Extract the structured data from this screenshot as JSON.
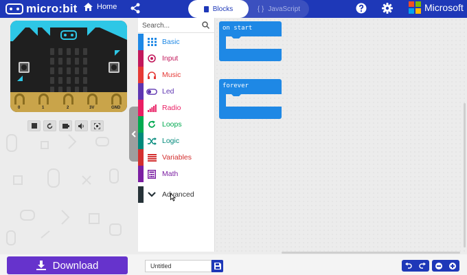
{
  "header": {
    "brand": "micro:bit",
    "home_label": "Home",
    "tabs": [
      {
        "label": "Blocks",
        "active": true
      },
      {
        "label": "JavaScript",
        "active": false
      }
    ],
    "microsoft_label": "Microsoft"
  },
  "simulator": {
    "pin_labels": [
      "0",
      "1",
      "2",
      "3V",
      "GND"
    ],
    "controls": [
      "stop-icon",
      "restart-icon",
      "slow-motion-icon",
      "sound-icon",
      "fullscreen-icon"
    ]
  },
  "toolbox": {
    "search_placeholder": "Search...",
    "categories": [
      {
        "label": "Basic",
        "color": "#1e88e5",
        "icon": "grid-icon"
      },
      {
        "label": "Input",
        "color": "#c2185b",
        "icon": "target-icon"
      },
      {
        "label": "Music",
        "color": "#e53935",
        "icon": "headphones-icon"
      },
      {
        "label": "Led",
        "color": "#5e35b1",
        "icon": "toggle-icon"
      },
      {
        "label": "Radio",
        "color": "#e91e63",
        "icon": "signal-icon"
      },
      {
        "label": "Loops",
        "color": "#00a94f",
        "icon": "refresh-icon"
      },
      {
        "label": "Logic",
        "color": "#00897b",
        "icon": "shuffle-icon"
      },
      {
        "label": "Variables",
        "color": "#d32f2f",
        "icon": "lines-icon"
      },
      {
        "label": "Math",
        "color": "#7b1fa2",
        "icon": "calculator-icon"
      }
    ],
    "advanced": {
      "label": "Advanced",
      "color": "#263238"
    }
  },
  "workspace": {
    "blocks": [
      {
        "label": "on start"
      },
      {
        "label": "forever"
      }
    ],
    "block_color": "#1e88e5"
  },
  "footer": {
    "download_label": "Download",
    "project_name": "Untitled"
  },
  "colors": {
    "header_bg": "#1e38b8",
    "download_bg": "#6633cc"
  }
}
